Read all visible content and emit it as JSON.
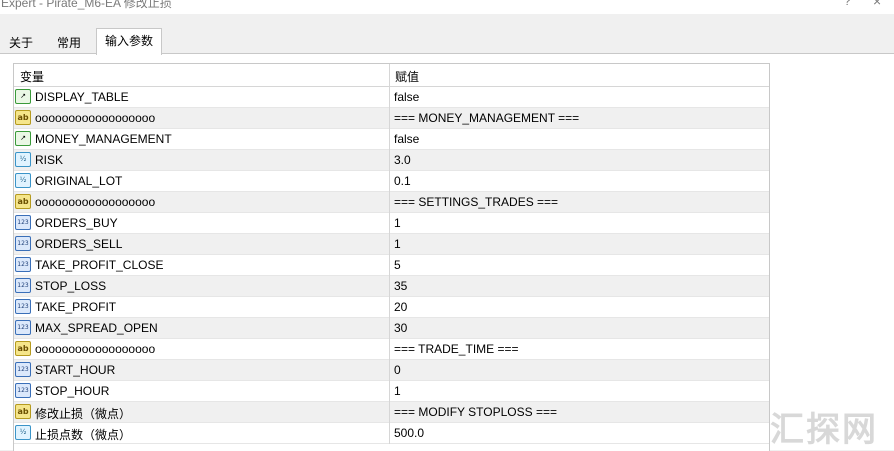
{
  "window": {
    "title": "Expert - Pirate_M6-EA 修改止损",
    "help_label": "?",
    "close_label": "×"
  },
  "tabs": [
    {
      "label": "关于",
      "active": false
    },
    {
      "label": "常用",
      "active": false
    },
    {
      "label": "输入参数",
      "active": true
    }
  ],
  "grid": {
    "columns": {
      "variable": "变量",
      "value": "赋值"
    },
    "rows": [
      {
        "icon": "bool-icon",
        "name": "DISPLAY_TABLE",
        "value": "false"
      },
      {
        "icon": "string-icon",
        "name": "oooooooooooooooooo",
        "value": "=== MONEY_MANAGEMENT ==="
      },
      {
        "icon": "bool-icon",
        "name": "MONEY_MANAGEMENT",
        "value": "false"
      },
      {
        "icon": "double-icon",
        "name": "RISK",
        "value": "3.0"
      },
      {
        "icon": "double-icon",
        "name": "ORIGINAL_LOT",
        "value": "0.1"
      },
      {
        "icon": "string-icon",
        "name": "oooooooooooooooooo",
        "value": "=== SETTINGS_TRADES ==="
      },
      {
        "icon": "int-icon",
        "name": "ORDERS_BUY",
        "value": "1"
      },
      {
        "icon": "int-icon",
        "name": "ORDERS_SELL",
        "value": "1"
      },
      {
        "icon": "int-icon",
        "name": "TAKE_PROFIT_CLOSE",
        "value": "5"
      },
      {
        "icon": "int-icon",
        "name": "STOP_LOSS",
        "value": "35"
      },
      {
        "icon": "int-icon",
        "name": "TAKE_PROFIT",
        "value": "20"
      },
      {
        "icon": "int-icon",
        "name": "MAX_SPREAD_OPEN",
        "value": "30"
      },
      {
        "icon": "string-icon",
        "name": "oooooooooooooooooo",
        "value": "=== TRADE_TIME ==="
      },
      {
        "icon": "int-icon",
        "name": "START_HOUR",
        "value": "0"
      },
      {
        "icon": "int-icon",
        "name": "STOP_HOUR",
        "value": "1"
      },
      {
        "icon": "string-icon",
        "name": "修改止损（微点）",
        "value": "=== MODIFY STOPLOSS ==="
      },
      {
        "icon": "double-icon",
        "name": "止损点数（微点）",
        "value": "500.0"
      }
    ]
  },
  "icon_glyphs": {
    "bool-icon": "↗",
    "string-icon": "ab",
    "double-icon": "½",
    "int-icon": "123"
  },
  "watermark": "汇探网"
}
